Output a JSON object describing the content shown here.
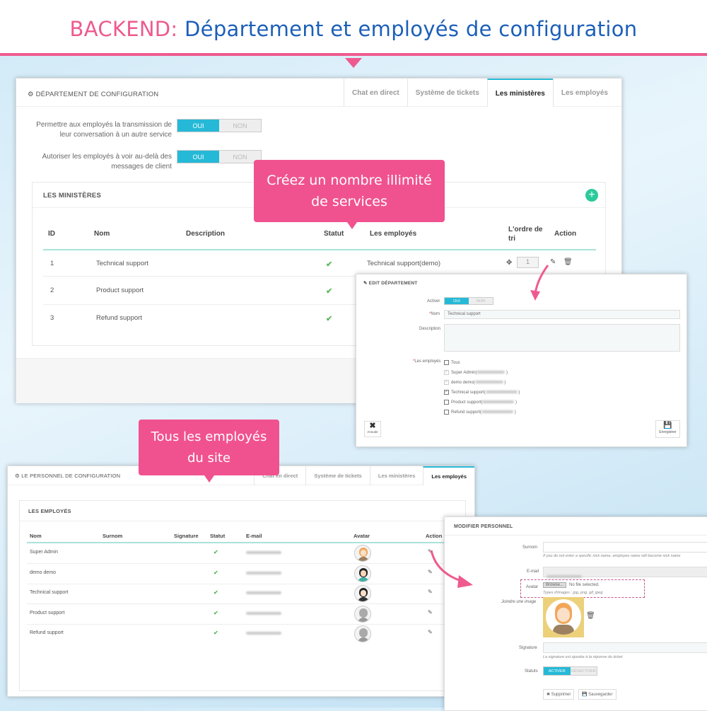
{
  "banner": {
    "prefix": "BACKEND:",
    "title": "Département et employés de configuration"
  },
  "colors": {
    "accent": "#25b9d7",
    "pink": "#f0528f",
    "title_blue": "#1c5fb8",
    "success": "#5cb85c",
    "add_button": "#2bcb9b"
  },
  "dept_panel": {
    "title": "DÉPARTEMENT DE CONFIGURATION",
    "tabs": [
      {
        "label": "Chat en direct"
      },
      {
        "label": "Système de tickets"
      },
      {
        "label": "Les ministères",
        "active": true
      },
      {
        "label": "Les employés"
      }
    ],
    "settings": [
      {
        "label": "Permettre aux employés la transmission de leur conversation à un autre service",
        "on": "OUI",
        "off": "NON",
        "value": "OUI"
      },
      {
        "label": "Autoriser les employés à voir au-delà des messages de client",
        "on": "OUI",
        "off": "NON",
        "value": "OUI"
      }
    ],
    "section_title": "LES MINISTÈRES",
    "columns": [
      "ID",
      "Nom",
      "Description",
      "Statut",
      "Les employés",
      "L'ordre de tri",
      "Action"
    ],
    "rows": [
      {
        "id": "1",
        "name": "Technical support",
        "description": "",
        "status": "✔",
        "employees": "Technical  support(demo)",
        "order": "1"
      },
      {
        "id": "2",
        "name": "Product support",
        "description": "",
        "status": "✔"
      },
      {
        "id": "3",
        "name": "Refund support",
        "description": "",
        "status": "✔"
      }
    ]
  },
  "callout_services": {
    "line1": "Créez un nombre illimité",
    "line2": "de services"
  },
  "edit_dept": {
    "title": "EDIT DÉPARTEMENT",
    "activer_label": "Activer",
    "on": "OUI",
    "off": "NON",
    "nom_label": "Nom",
    "nom_value": "Technical support",
    "description_label": "Description",
    "employees_label": "Les employés",
    "employees": [
      {
        "label": "Tous",
        "checked": false
      },
      {
        "label": "Super Admin(",
        "checked": true,
        "disabled": true
      },
      {
        "label": "demo demo(",
        "checked": true,
        "disabled": true
      },
      {
        "label": "Technical  support(",
        "checked": true
      },
      {
        "label": "Product support(",
        "checked": false
      },
      {
        "label": "Refund  support(",
        "checked": false
      }
    ],
    "cancel": "Annuler",
    "save": "Enregistrer"
  },
  "callout_employees": {
    "line1": "Tous les employés",
    "line2": "du site"
  },
  "staff_panel": {
    "title": "LE PERSONNEL DE CONFIGURATION",
    "tabs": [
      {
        "label": "Chat en direct"
      },
      {
        "label": "Système de tickets"
      },
      {
        "label": "Les ministères"
      },
      {
        "label": "Les employés",
        "active": true
      }
    ],
    "section_title": "LES EMPLOYÉS",
    "columns": [
      "Nom",
      "Surnom",
      "Signature",
      "Statut",
      "E-mail",
      "Avatar",
      "Action"
    ],
    "rows": [
      {
        "name": "Super Admin",
        "status": "✔",
        "avatar": "woman-headset"
      },
      {
        "name": "demo demo",
        "status": "✔",
        "avatar": "man"
      },
      {
        "name": "Technical  support",
        "status": "✔",
        "avatar": "woman-dark-hair"
      },
      {
        "name": "Product support",
        "status": "✔",
        "avatar": "default"
      },
      {
        "name": "Refund  support",
        "status": "✔",
        "avatar": "default"
      }
    ]
  },
  "modify_staff": {
    "title": "MODIFIER PERSONNEL",
    "surnom_label": "Surnom",
    "surnom_hint": "If you do not enter a specific nick name, employee name will become nick name",
    "email_label": "E-mail",
    "avatar_label": "Avatar",
    "browse": "Browse...",
    "no_file": "No file selected.",
    "types_hint": "Types d'images : jpg, png, gif, jpeg",
    "attach_label": "Joindre une image",
    "signature_label": "Signature",
    "signature_hint": "La signature est ajoutée à la réponse du ticket",
    "status_label": "Statuts",
    "activate": "ACTIVER",
    "deactivate": "DÉSACTIVER",
    "delete": "Supprimer",
    "save": "Sauvegarder"
  }
}
